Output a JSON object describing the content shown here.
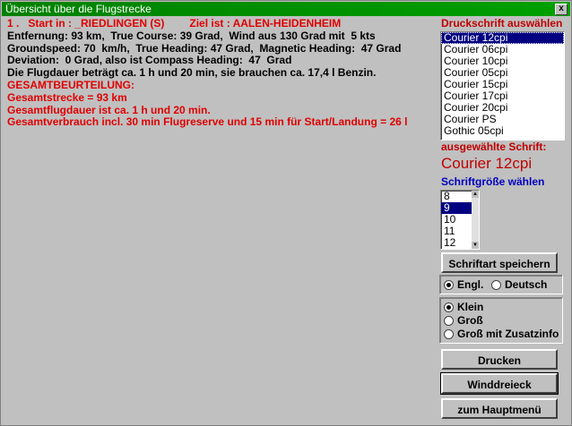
{
  "window": {
    "title": "Übersicht über die Flugstrecke",
    "close_glyph": "x"
  },
  "route": {
    "start_line_prefix": "1 .   Start in : _RIEDLINGEN (S)",
    "ziel": "Ziel ist : AALEN-HEIDENHEIM",
    "line2": "Entfernung: 93 km,  True Course: 39 Grad,  Wind aus 130 Grad mit  5 kts",
    "line3": "Groundspeed: 70  km/h,  True Heading: 47 Grad,  Magnetic Heading:  47 Grad",
    "line4": "Deviation:  0 Grad, also ist Compass Heading:  47  Grad",
    "line5": "Die Flugdauer beträgt ca. 1 h und 20 min, sie brauchen ca. 17,4 l Benzin.",
    "summary_title": "GESAMTBEURTEILUNG:",
    "summary1": "Gesamtstrecke = 93 km",
    "summary2": "Gesamtflugdauer ist ca. 1 h und 20 min.",
    "summary3": "Gesamtverbrauch incl. 30 min Flugreserve und 15 min für Start/Landung = 26 l"
  },
  "font_panel": {
    "label": "Druckschrift auswählen",
    "fonts": [
      "Courier 12cpi",
      "Courier 06cpi",
      "Courier 10cpi",
      "Courier 05cpi",
      "Courier 15cpi",
      "Courier 17cpi",
      "Courier 20cpi",
      "Courier PS",
      "Gothic 05cpi"
    ],
    "selected_index": 0,
    "selected_label": "ausgewählte Schrift:",
    "selected_font": "Courier 12cpi",
    "size_label": "Schriftgröße wählen",
    "sizes": [
      "8",
      "9",
      "10",
      "11",
      "12"
    ],
    "selected_size_index": 1,
    "save_button": "Schriftart speichern"
  },
  "language": {
    "opt1": "Engl.",
    "opt2": "Deutsch",
    "selected": "Engl."
  },
  "mode": {
    "opt1": "Klein",
    "opt2": "Groß",
    "opt3": "Groß mit Zusatzinfo",
    "selected": "Klein"
  },
  "buttons": {
    "print": "Drucken",
    "wind": "Winddreieck",
    "main": "zum Hauptmenü"
  }
}
